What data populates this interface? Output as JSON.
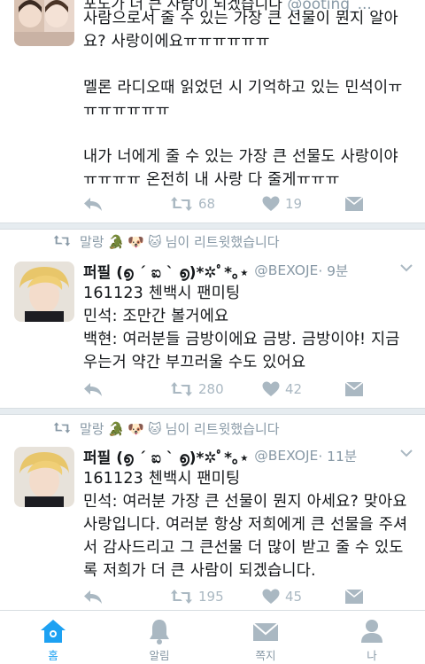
{
  "tweet1": {
    "top_cut_text": "포도가 더 큰 사람이 되겠습니다",
    "top_cut_handle": "@ooting_...",
    "lines": [
      "사람으로서 줄 수 있는 가장 큰 선물이 뭔지 알아",
      "요? 사랑이에요ㅠㅠㅠㅠㅠㅠ",
      "",
      "멜론 라디오때 읽었던 시 기억하고 있는 민석이ㅠ",
      "ㅠㅠㅠㅠㅠㅠ",
      "",
      "내가 너에게 줄 수 있는 가장 큰 선물도 사랑이야",
      "ㅠㅠㅠㅠ 온전히 내 사랑 다 줄게ㅠㅠㅠ"
    ],
    "retweets": "68",
    "likes": "19"
  },
  "tweet2": {
    "retweeted_by": "말랑",
    "retweeted_suffix": "님이 리트윗했습니다",
    "name": "퍼필 (൭ ˊ ಐ ˋ ൭)*✲ﾟ*｡⋆",
    "handle": "@BEXOJE",
    "time": "· 9분",
    "lines": [
      "161123 첸백시 팬미팅",
      "민석: 조만간 볼거에요",
      "백현: 여러분들 금방이에요 금방. 금방이야! 지금",
      "우는거 약간 부끄러울 수도 있어요"
    ],
    "retweets": "280",
    "likes": "42"
  },
  "tweet3": {
    "retweeted_by": "말랑",
    "retweeted_suffix": "님이 리트윗했습니다",
    "name": "퍼필 (൭ ˊ ಐ ˋ ൭)*✲ﾟ*｡⋆",
    "handle": "@BEXOJE",
    "time": "· 11분",
    "lines": [
      "161123 첸백시 팬미팅",
      "민석: 여러분 가장 큰 선물이 뭔지 아세요? 맞아요",
      "사랑입니다. 여러분 항상 저희에게 큰 선물을 주셔",
      "서 감사드리고 그 큰선물 더 많이 받고 줄 수 있도",
      "록 저희가 더 큰 사람이 되겠습니다."
    ],
    "retweets": "195",
    "likes": "45"
  },
  "tabbar": {
    "home": "홈",
    "notifications": "알림",
    "messages": "쪽지",
    "me": "나"
  },
  "colors": {
    "accent": "#1da1f2",
    "icon_gray": "#aab8c2",
    "text_gray": "#8899a6",
    "separator": "#e6ecf0"
  },
  "icons": [
    "reply-icon",
    "retweet-icon",
    "heart-icon",
    "dm-icon",
    "chevron-down-icon",
    "home-icon",
    "bell-icon",
    "envelope-icon",
    "person-icon"
  ]
}
